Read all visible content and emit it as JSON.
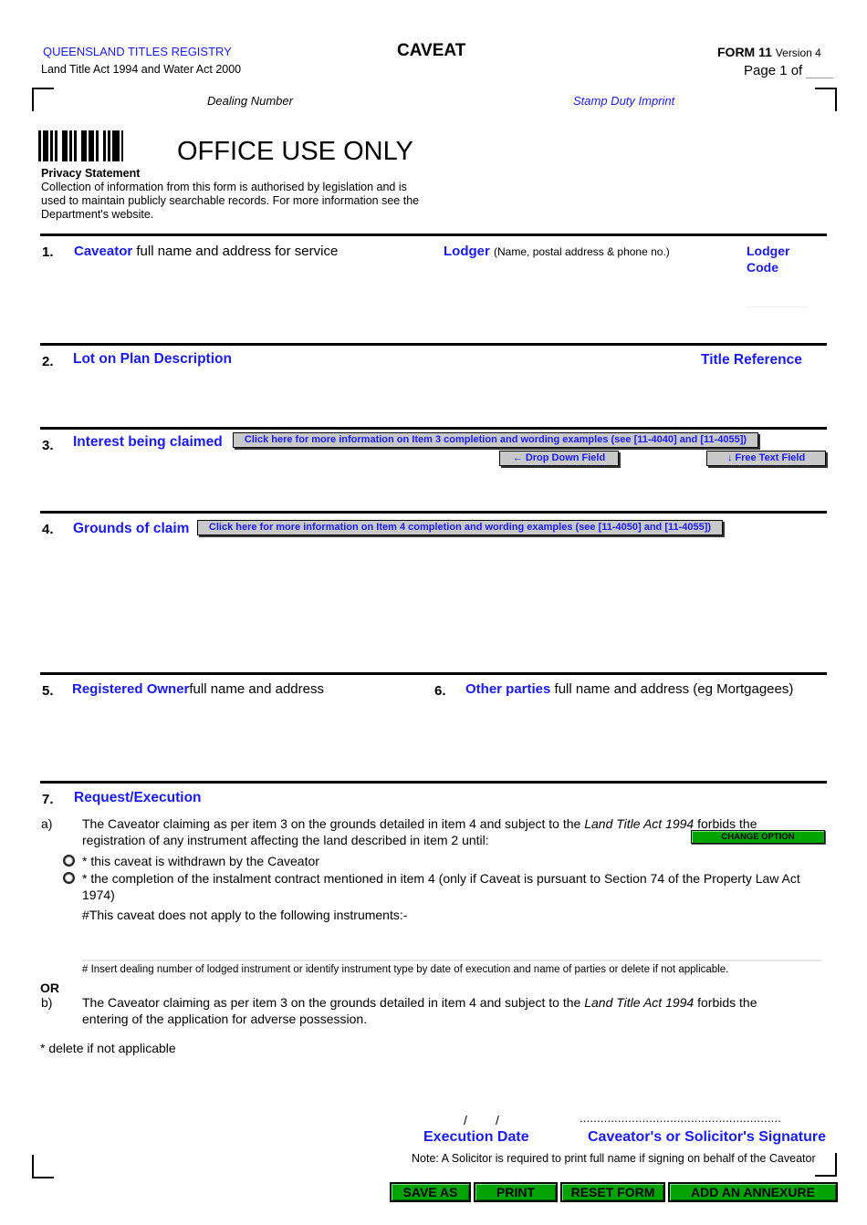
{
  "header": {
    "registry": "QUEENSLAND TITLES REGISTRY",
    "act": "Land Title Act 1994 and Water Act 2000",
    "title": "CAVEAT",
    "form_number": "FORM 11",
    "version": "Version 4",
    "page_label": "Page 1 of",
    "page_total": "",
    "dealing_number_label": "Dealing Number",
    "stamp_duty_label": "Stamp Duty Imprint",
    "office_use": "OFFICE USE ONLY"
  },
  "privacy": {
    "heading": "Privacy Statement",
    "text": "Collection of information from this form is authorised by legislation and is used to maintain publicly searchable records. For more information see the Department's website."
  },
  "items": {
    "item1": {
      "number": "1.",
      "label": "Caveator",
      "desc": "full name and address for service",
      "value": ""
    },
    "lodger": {
      "label": "Lodger",
      "desc": "(Name, postal address & phone no.)",
      "value": ""
    },
    "lodger_code": {
      "label_line1": "Lodger",
      "label_line2": "Code",
      "value": ""
    },
    "item2": {
      "number": "2.",
      "label": "Lot on Plan Description",
      "value": ""
    },
    "title_reference": {
      "label": "Title Reference",
      "value": ""
    },
    "item3": {
      "number": "3.",
      "label": "Interest being claimed",
      "info_button": "Click here for more information on Item 3 completion and wording examples (see [11-4040] and [11-4055])",
      "dropdown_hint": "← Drop Down Field",
      "freetext_hint": "↓ Free Text Field",
      "value": ""
    },
    "item4": {
      "number": "4.",
      "label": "Grounds of claim",
      "info_button": "Click here for more information on Item 4 completion and wording examples (see [11-4050] and [11-4055])",
      "value": ""
    },
    "item5": {
      "number": "5.",
      "label": "Registered Owner",
      "desc": "full name and address",
      "value": ""
    },
    "item6": {
      "number": "6.",
      "label": "Other parties",
      "desc": "full name and address (eg Mortgagees)",
      "value": ""
    },
    "item7": {
      "number": "7.",
      "label": "Request/Execution",
      "a_marker": "a)",
      "a_text_1": "The Caveator claiming as per item 3 on the grounds detailed in item 4 and subject to the ",
      "a_text_italic": "Land Title Act 1994",
      "a_text_2": " forbids the registration of any instrument affecting the land described in item 2 until:",
      "change_option": "CHANGE OPTION",
      "options": [
        {
          "label": "* this caveat is withdrawn by the Caveator",
          "selected": false
        },
        {
          "label": "* the completion of the instalment contract mentioned in item 4 (only if Caveat is pursuant to Section 74 of the Property Law Act 1974)",
          "selected": false
        }
      ],
      "exclusion_label": "#This caveat does not apply to the following instruments:-",
      "exclusion_value": "",
      "exclusion_note": "# Insert dealing number of lodged instrument or identify instrument type by date of execution and name of parties or delete if not applicable.",
      "or_label": "OR",
      "b_marker": "b)",
      "b_text_1": "The Caveator claiming as per item 3 on the grounds detailed in item 4 and subject to the ",
      "b_text_italic": "Land Title Act 1994",
      "b_text_2": " forbids the entering of the application for adverse possession.",
      "delete_note": "* delete if not applicable"
    }
  },
  "execution": {
    "date_slashes": "/        /",
    "date_label": "Execution Date",
    "signature_dots": "..........................................................",
    "signature_label": "Caveator's or Solicitor's Signature",
    "note": "Note: A Solicitor is required to print full name if signing on behalf of the Caveator"
  },
  "buttons": {
    "save_as": "SAVE AS",
    "print": "PRINT",
    "reset": "RESET FORM",
    "annexure": "ADD AN ANNEXURE"
  },
  "colors": {
    "accent_blue": "#1a1aff",
    "button_green": "#00a300",
    "info_gray": "#c8c8c8"
  }
}
